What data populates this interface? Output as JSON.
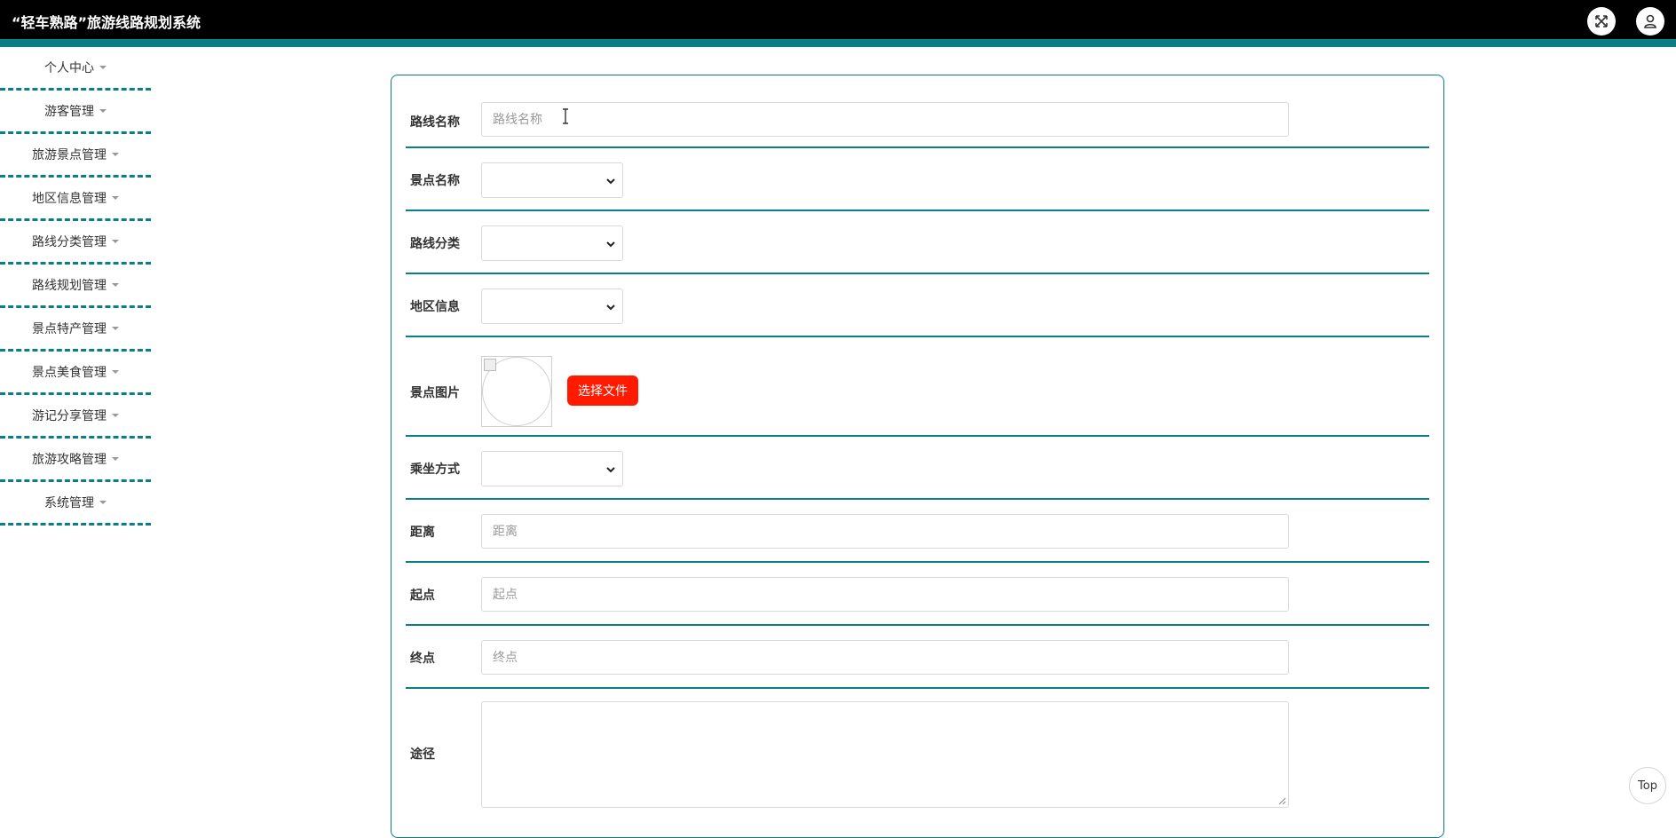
{
  "app": {
    "title": "“轻车熟路”旅游线路规划系统"
  },
  "header": {
    "fullscreen_icon": "fullscreen-icon",
    "user_icon": "user-icon"
  },
  "colors": {
    "accent": "#0b7f86",
    "header_bg": "#000000",
    "file_button": "#ff1a00"
  },
  "sidebar": {
    "items": [
      {
        "label": "个人中心"
      },
      {
        "label": "游客管理"
      },
      {
        "label": "旅游景点管理"
      },
      {
        "label": "地区信息管理"
      },
      {
        "label": "路线分类管理"
      },
      {
        "label": "路线规划管理"
      },
      {
        "label": "景点特产管理"
      },
      {
        "label": "景点美食管理"
      },
      {
        "label": "游记分享管理"
      },
      {
        "label": "旅游攻略管理"
      },
      {
        "label": "系统管理"
      }
    ]
  },
  "form": {
    "route_name": {
      "label": "路线名称",
      "placeholder": "路线名称",
      "value": ""
    },
    "scenic_name": {
      "label": "景点名称",
      "value": ""
    },
    "route_category": {
      "label": "路线分类",
      "value": ""
    },
    "region_info": {
      "label": "地区信息",
      "value": ""
    },
    "scenic_image": {
      "label": "景点图片",
      "button_label": "选择文件"
    },
    "transport": {
      "label": "乘坐方式",
      "value": ""
    },
    "distance": {
      "label": "距离",
      "placeholder": "距离",
      "value": ""
    },
    "start": {
      "label": "起点",
      "placeholder": "起点",
      "value": ""
    },
    "end": {
      "label": "终点",
      "placeholder": "终点",
      "value": ""
    },
    "path": {
      "label": "途径",
      "value": ""
    }
  },
  "back_to_top": {
    "label": "Top"
  }
}
